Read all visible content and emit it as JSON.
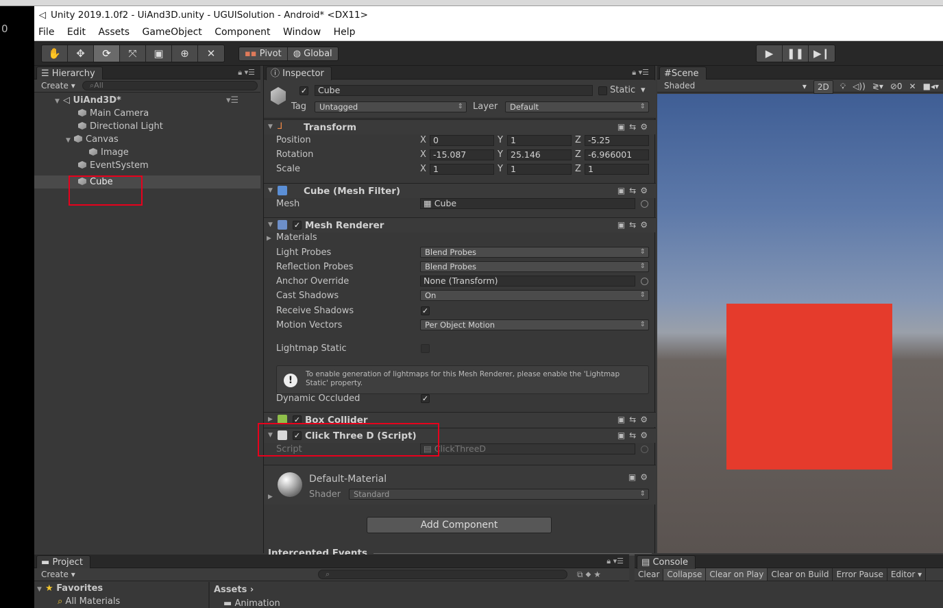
{
  "window": {
    "title": "Unity 2019.1.0f2 - UiAnd3D.unity - UGUISolution - Android* <DX11>",
    "edge_text": "0"
  },
  "menu": [
    "File",
    "Edit",
    "Assets",
    "GameObject",
    "Component",
    "Window",
    "Help"
  ],
  "toolbar": {
    "pivot_label": "Pivot",
    "global_label": "Global"
  },
  "hierarchy": {
    "tab": "Hierarchy",
    "create": "Create",
    "search_placeholder": "All",
    "scene": "UiAnd3D*",
    "items": [
      "Main Camera",
      "Directional Light",
      "Canvas",
      "Image",
      "EventSystem",
      "Cube"
    ]
  },
  "inspector": {
    "tab": "Inspector",
    "object_name": "Cube",
    "static_label": "Static",
    "tag_label": "Tag",
    "tag_value": "Untagged",
    "layer_label": "Layer",
    "layer_value": "Default",
    "transform": {
      "title": "Transform",
      "position_label": "Position",
      "rotation_label": "Rotation",
      "scale_label": "Scale",
      "position": [
        "0",
        "1",
        "-5.25"
      ],
      "rotation": [
        "-15.087",
        "25.146",
        "-6.966001"
      ],
      "scale": [
        "1",
        "1",
        "1"
      ],
      "axis_x": "X",
      "axis_y": "Y",
      "axis_z": "Z"
    },
    "mesh_filter": {
      "title": "Cube (Mesh Filter)",
      "mesh_label": "Mesh",
      "mesh_value": "Cube"
    },
    "mesh_renderer": {
      "title": "Mesh Renderer",
      "materials_label": "Materials",
      "light_probes_label": "Light Probes",
      "light_probes_value": "Blend Probes",
      "reflection_probes_label": "Reflection Probes",
      "reflection_probes_value": "Blend Probes",
      "anchor_override_label": "Anchor Override",
      "anchor_override_value": "None (Transform)",
      "cast_shadows_label": "Cast Shadows",
      "cast_shadows_value": "On",
      "receive_shadows_label": "Receive Shadows",
      "motion_vectors_label": "Motion Vectors",
      "motion_vectors_value": "Per Object Motion",
      "lightmap_static_label": "Lightmap Static",
      "help_text": "To enable generation of lightmaps for this Mesh Renderer, please enable the 'Lightmap Static' property.",
      "dynamic_occluded_label": "Dynamic Occluded"
    },
    "box_collider": {
      "title": "Box Collider"
    },
    "click_script": {
      "title": "Click Three D (Script)",
      "script_label": "Script",
      "script_value": "ClickThreeD"
    },
    "material": {
      "name": "Default-Material",
      "shader_label": "Shader",
      "shader_value": "Standard"
    },
    "add_component": "Add Component",
    "intercepted": "Intercepted Events"
  },
  "scene": {
    "tab": "Scene",
    "shading": "Shaded",
    "btn_2d": "2D",
    "hidden_count": "0",
    "cube_color": "#e53b2c"
  },
  "project": {
    "tab": "Project",
    "create": "Create",
    "favorites": "Favorites",
    "all_materials": "All Materials",
    "assets": "Assets",
    "animation": "Animation"
  },
  "console": {
    "tab": "Console",
    "buttons": [
      "Clear",
      "Collapse",
      "Clear on Play",
      "Clear on Build",
      "Error Pause",
      "Editor"
    ]
  }
}
